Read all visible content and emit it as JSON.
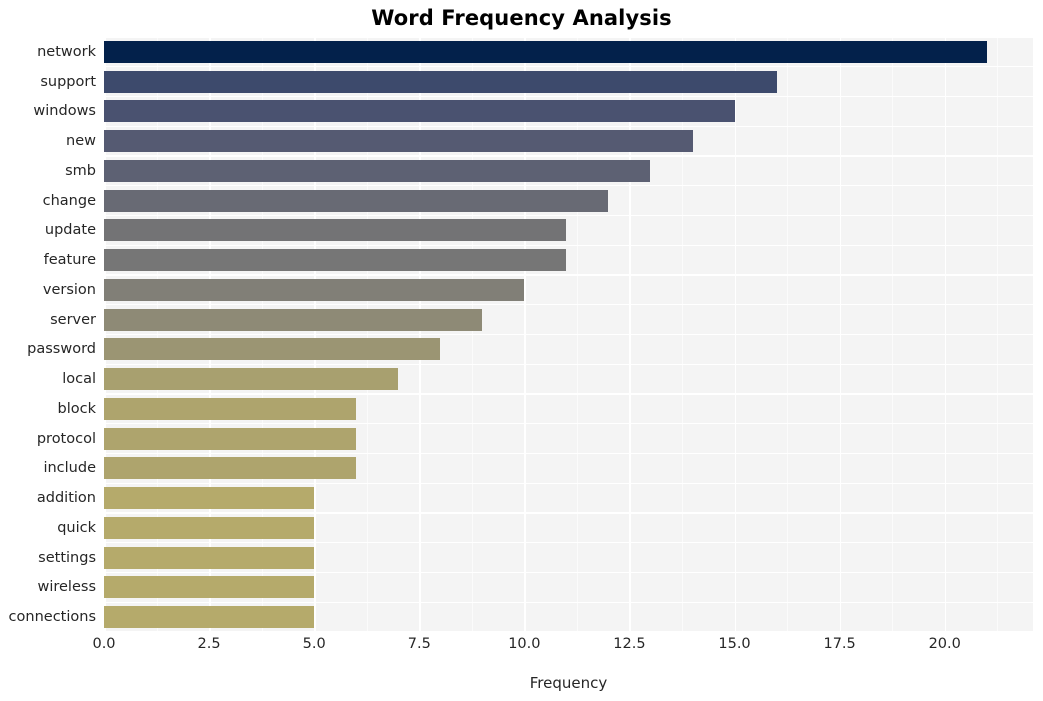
{
  "chart_data": {
    "type": "bar",
    "orientation": "horizontal",
    "title": "Word Frequency Analysis",
    "xlabel": "Frequency",
    "ylabel": "",
    "categories": [
      "network",
      "support",
      "windows",
      "new",
      "smb",
      "change",
      "update",
      "feature",
      "version",
      "server",
      "password",
      "local",
      "block",
      "protocol",
      "include",
      "addition",
      "quick",
      "settings",
      "wireless",
      "connections"
    ],
    "values": [
      21,
      16,
      15,
      14,
      13,
      12,
      11,
      11,
      10,
      9,
      8,
      7,
      6,
      6,
      6,
      5,
      5,
      5,
      5,
      5
    ],
    "bar_colors": [
      "#03214b",
      "#3d4a6c",
      "#4a5270",
      "#555a72",
      "#5d6173",
      "#686a74",
      "#737375",
      "#767676",
      "#817f77",
      "#8e8a76",
      "#9b9573",
      "#a8a06f",
      "#ae a46d",
      "#aea46d",
      "#aea46d",
      "#b5aa6b",
      "#b5aa6b",
      "#b5aa6b",
      "#b5aa6b",
      "#b5aa6b"
    ],
    "xlim": [
      0,
      22.1
    ],
    "xticks": [
      "0.0",
      "2.5",
      "5.0",
      "7.5",
      "10.0",
      "12.5",
      "15.0",
      "17.5",
      "20.0"
    ],
    "xtick_values": [
      0,
      2.5,
      5,
      7.5,
      10,
      12.5,
      15,
      17.5,
      20
    ],
    "grid": true,
    "legend": null,
    "plot_background": "#f4f4f4",
    "figure_background": "#ffffff",
    "colormap": "cividis"
  }
}
